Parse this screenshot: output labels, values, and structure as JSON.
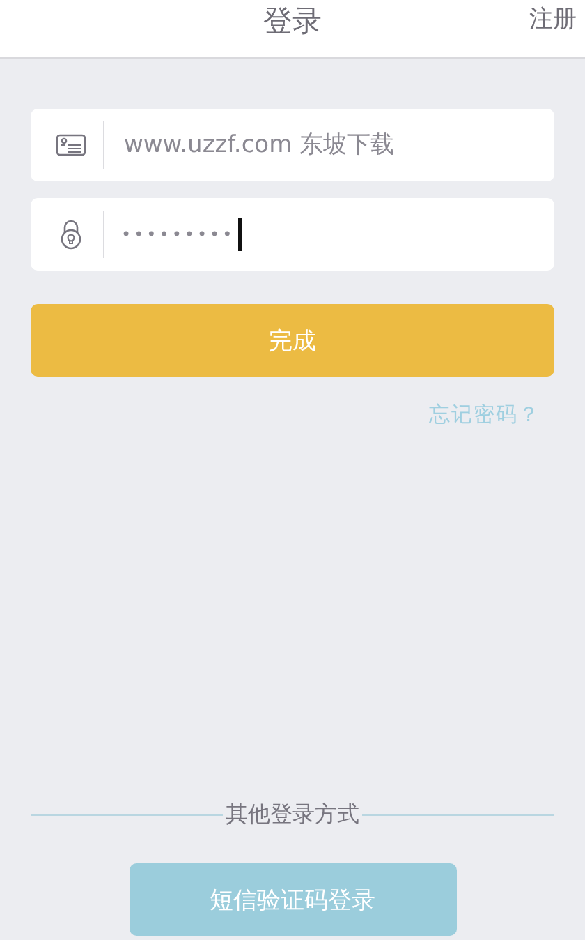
{
  "header": {
    "title": "登录",
    "action": "注册"
  },
  "username": {
    "placeholder": "www.uzzf.com 东坡下载"
  },
  "password": {
    "value": "•••••••••",
    "focused": true
  },
  "submit": "完成",
  "forgot": "忘记密码？",
  "divider": "其他登录方式",
  "sms_button": "短信验证码登录"
}
